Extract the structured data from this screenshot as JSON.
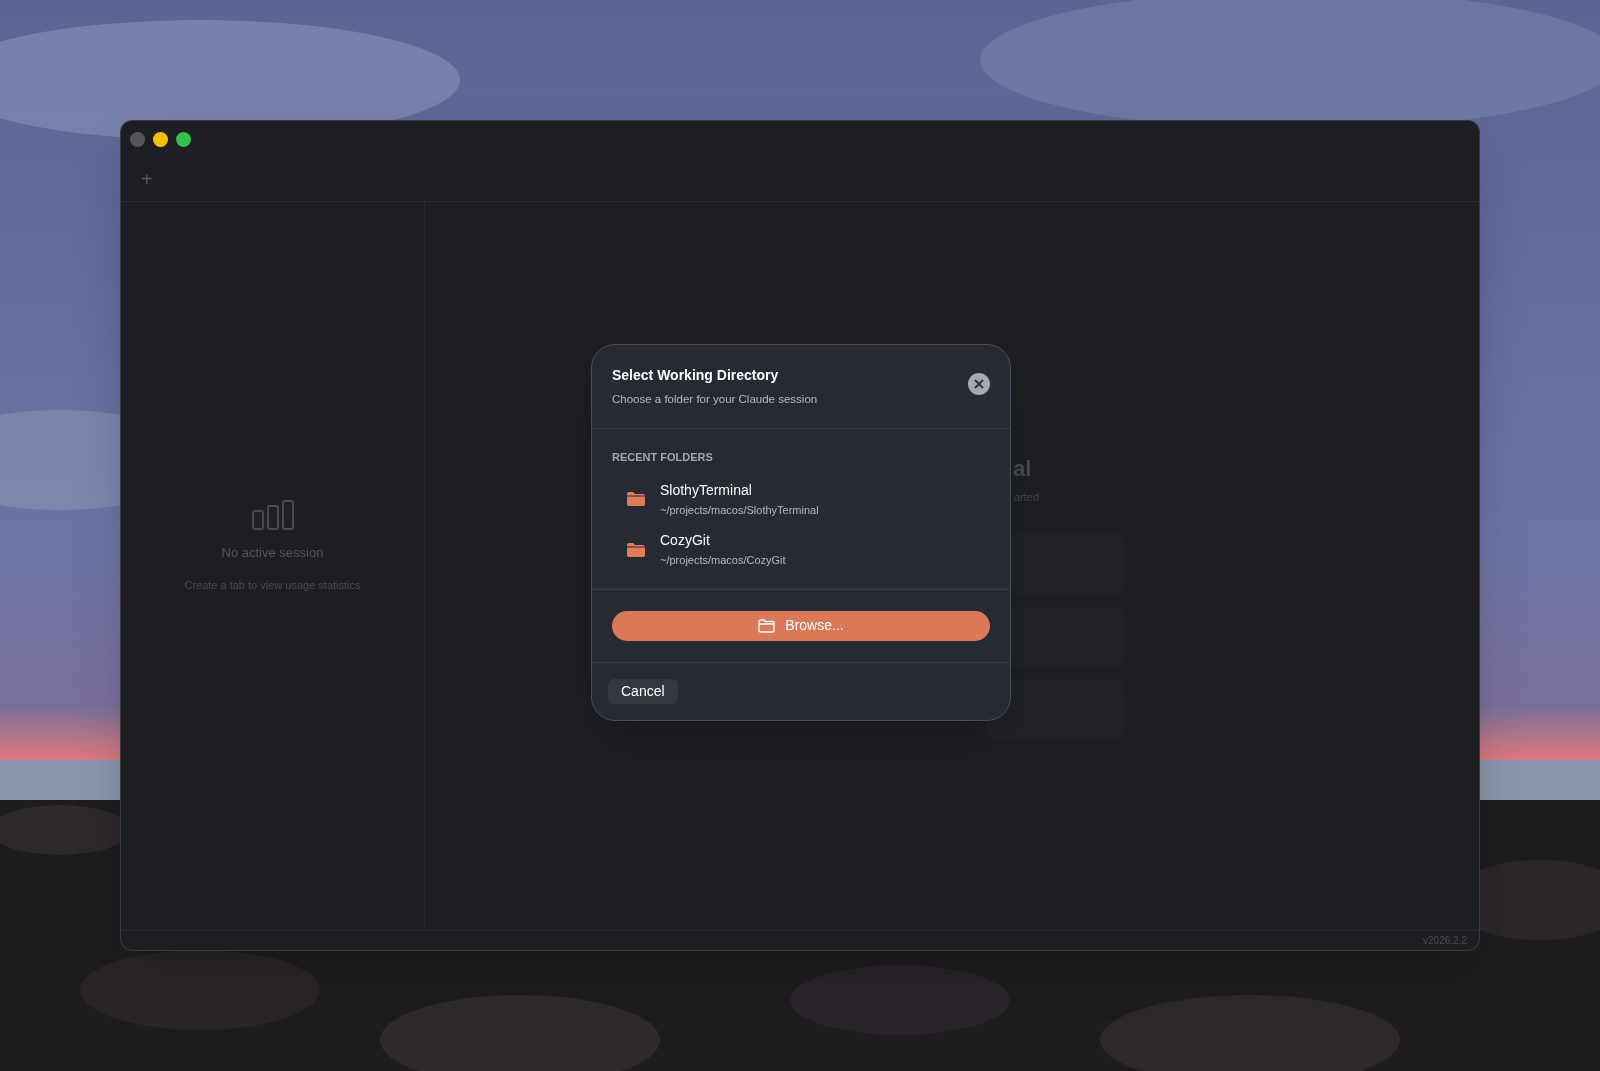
{
  "window": {
    "new_tab_label": "+",
    "version": "v2026.2.2"
  },
  "sidebar": {
    "title": "No active session",
    "subtitle": "Create a tab to view usage statistics"
  },
  "main_behind": {
    "title_fragment": "al",
    "subtitle_fragment": "arted"
  },
  "dialog": {
    "title": "Select Working Directory",
    "subtitle": "Choose a folder for your Claude session",
    "section_label": "RECENT FOLDERS",
    "folders": [
      {
        "name": "SlothyTerminal",
        "path": "~/projects/macos/SlothyTerminal"
      },
      {
        "name": "CozyGit",
        "path": "~/projects/macos/CozyGit"
      }
    ],
    "browse_label": "Browse...",
    "cancel_label": "Cancel"
  }
}
